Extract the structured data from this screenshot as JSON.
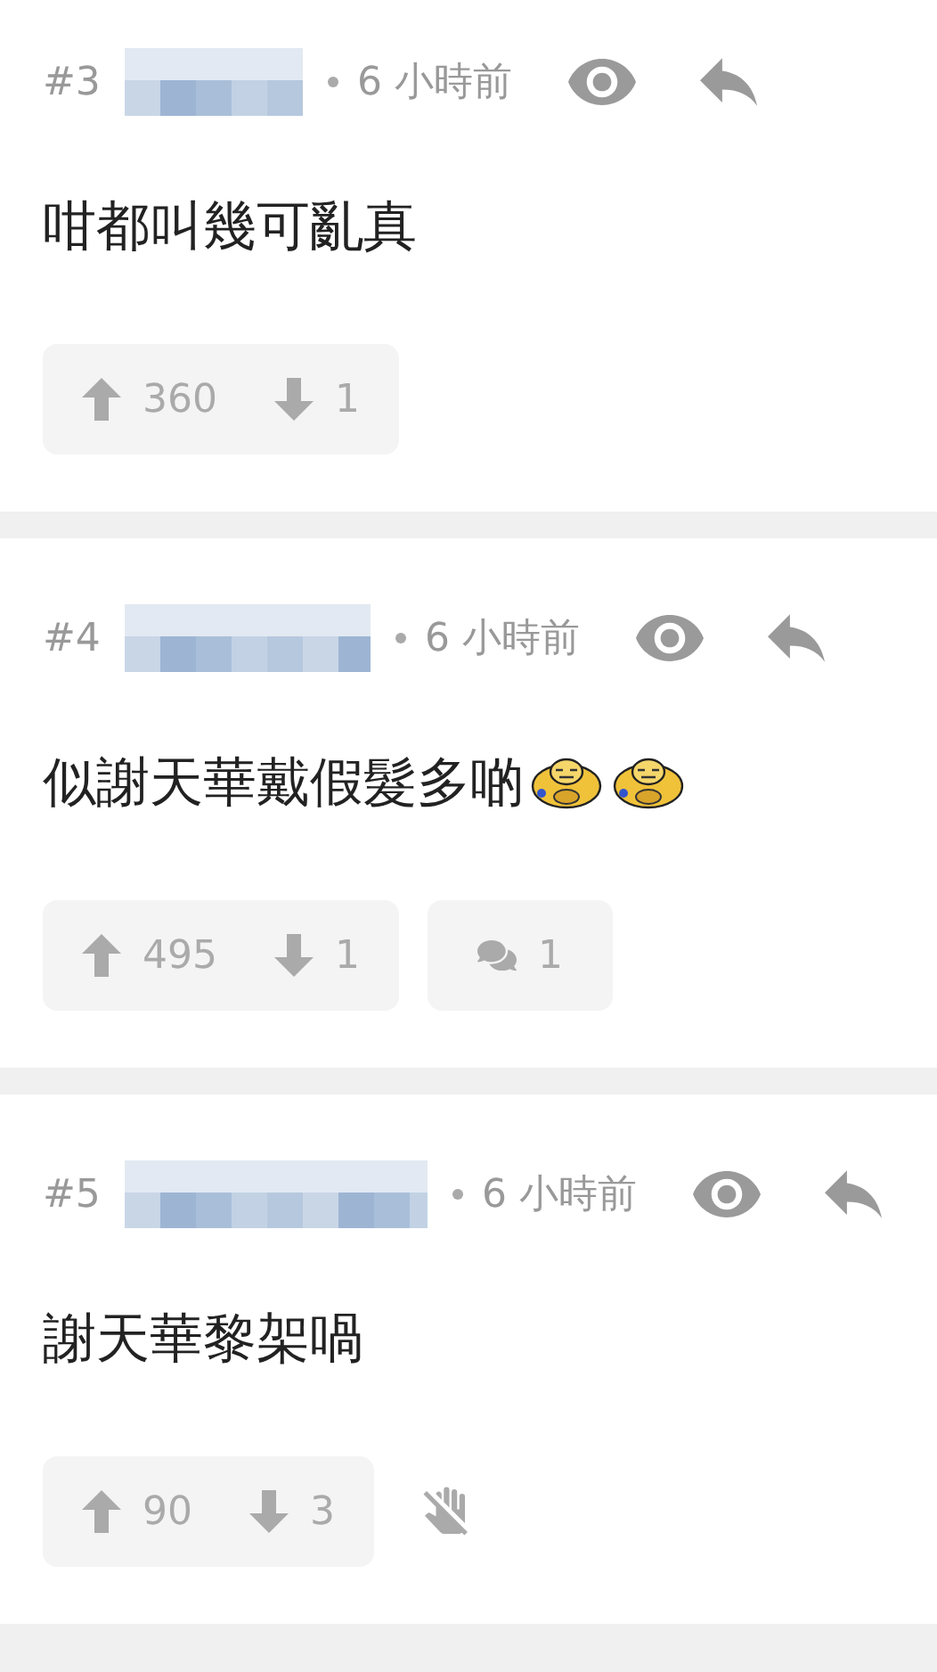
{
  "posts": [
    {
      "number": "#3",
      "time": "6 小時前",
      "content": [
        {
          "kind": "text",
          "text": "咁都叫幾可亂真"
        }
      ],
      "upvotes": "360",
      "downvotes": "1",
      "extra": {
        "kind": "none"
      }
    },
    {
      "number": "#4",
      "time": "6 小時前",
      "content": [
        {
          "kind": "text",
          "text": "似謝天華戴假髮多啲"
        },
        {
          "kind": "emoji"
        },
        {
          "kind": "emoji"
        }
      ],
      "upvotes": "495",
      "downvotes": "1",
      "extra": {
        "kind": "replies",
        "count": "1"
      }
    },
    {
      "number": "#5",
      "time": "6 小時前",
      "content": [
        {
          "kind": "text",
          "text": "謝天華黎架喎"
        }
      ],
      "upvotes": "90",
      "downvotes": "3",
      "extra": {
        "kind": "block"
      }
    }
  ]
}
